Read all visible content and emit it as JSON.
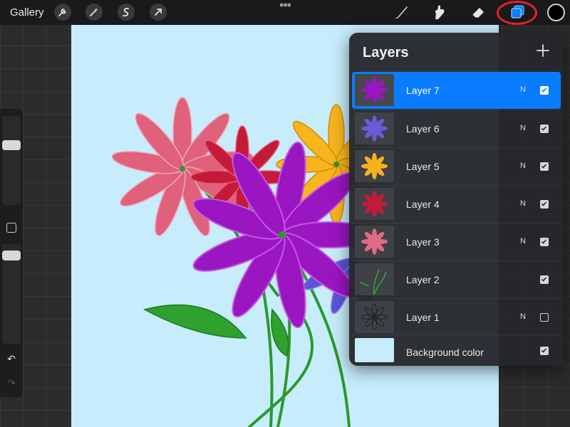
{
  "toolbar": {
    "gallery_label": "Gallery",
    "left_tools": [
      "wrench-icon",
      "magic-wand-icon",
      "selection-icon",
      "transform-arrow-icon"
    ],
    "right_tools": [
      "brush-icon",
      "smudge-icon",
      "eraser-icon",
      "layers-icon"
    ],
    "more": "•••",
    "current_color": "#000000",
    "highlight_color": "#e0242c"
  },
  "layers": {
    "title": "Layers",
    "add_icon": "plus-icon",
    "items": [
      {
        "name": "Layer 7",
        "blend": "N",
        "visible": true,
        "active": true,
        "thumb_color": "#9a16c0"
      },
      {
        "name": "Layer 6",
        "blend": "N",
        "visible": true,
        "active": false,
        "thumb_color": "#6a5ad8"
      },
      {
        "name": "Layer 5",
        "blend": "N",
        "visible": true,
        "active": false,
        "thumb_color": "#f5b21d"
      },
      {
        "name": "Layer 4",
        "blend": "N",
        "visible": true,
        "active": false,
        "thumb_color": "#c41a3a"
      },
      {
        "name": "Layer 3",
        "blend": "N",
        "visible": true,
        "active": false,
        "thumb_color": "#e06a84"
      },
      {
        "name": "Layer 2",
        "blend": "",
        "visible": true,
        "active": false,
        "thumb_color": "#3aa63a"
      },
      {
        "name": "Layer 1",
        "blend": "N",
        "visible": false,
        "active": false,
        "thumb_color": "#1a1a1a"
      }
    ],
    "background": {
      "name": "Background color",
      "visible": true,
      "color": "#c7ecfc"
    }
  },
  "sidebar": {
    "undo_icon": "↶",
    "redo_icon": "↷"
  },
  "colors": {
    "accent": "#0a7cff",
    "canvas_bg": "#c7ecfc"
  }
}
